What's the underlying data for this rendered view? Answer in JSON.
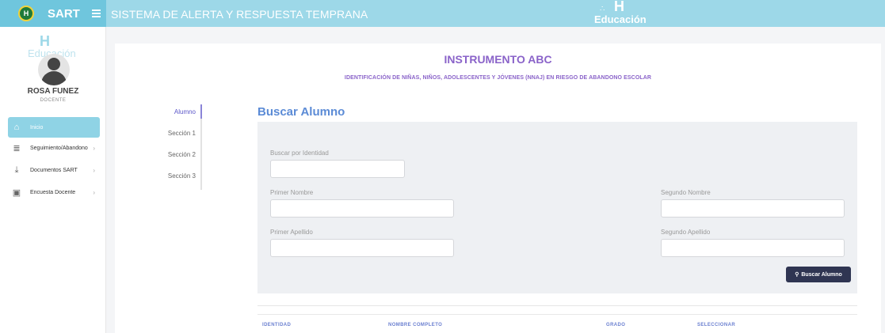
{
  "topbar": {
    "logo_text": "H",
    "brand": "SART",
    "app_title": "SISTEMA DE ALERTA Y RESPUESTA TEMPRANA",
    "edu_logo_mark": "H",
    "edu_logo_text": "Educación"
  },
  "sidebar": {
    "logo_mark": "H",
    "logo_text": "Educación",
    "user_name": "ROSA FUNEZ",
    "user_role": "DOCENTE",
    "items": [
      {
        "label": "Inicio",
        "icon": "home-icon",
        "active": true
      },
      {
        "label": "Seguimiento/Abandono",
        "icon": "database-icon",
        "active": false
      },
      {
        "label": "Documentos SART",
        "icon": "download-icon",
        "active": false
      },
      {
        "label": "Encuesta Docente",
        "icon": "chart-icon",
        "active": false
      }
    ]
  },
  "main": {
    "title": "INSTRUMENTO ABC",
    "subtitle": "IDENTIFICACIÓN DE NIÑAS, NIÑOS, ADOLESCENTES Y JÓVENES (NNAJ) EN RIESGO DE ABANDONO ESCOLAR",
    "steps": [
      "Alumno",
      "Sección 1",
      "Sección 2",
      "Sección 3"
    ],
    "active_step": "Alumno",
    "section_title": "Buscar Alumno",
    "form": {
      "id_label": "Buscar por Identidad",
      "id_value": "",
      "first_name_label": "Primer Nombre",
      "first_name_value": "",
      "second_name_label": "Segundo Nombre",
      "second_name_value": "",
      "first_surname_label": "Primer Apellido",
      "first_surname_value": "",
      "second_surname_label": "Segundo Apellido",
      "second_surname_value": "",
      "search_button": "Buscar Alumno"
    },
    "table": {
      "columns": [
        "IDENTIDAD",
        "NOMBRE COMPLETO",
        "GRADO",
        "SELECCIONAR"
      ]
    }
  },
  "colors": {
    "topbar": "#9dd8e8",
    "brand_bg": "#6fc6dd",
    "accent_purple": "#8a63c9",
    "section_blue": "#5b8bd6",
    "button_dark": "#2f3552",
    "table_header": "#6a7fd0"
  }
}
